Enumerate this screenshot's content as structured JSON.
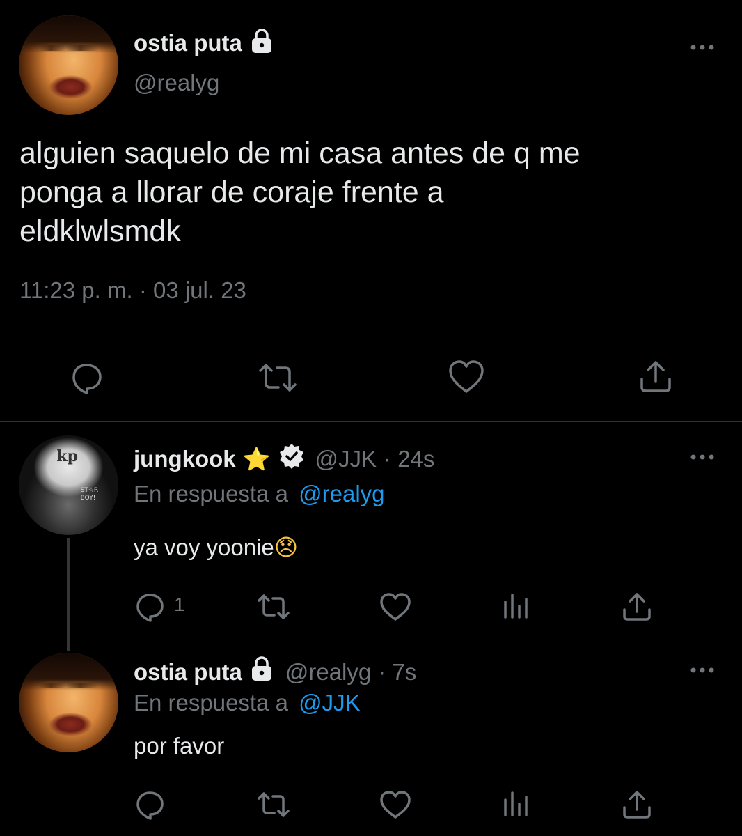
{
  "main_tweet": {
    "display_name": "ostia puta",
    "handle": "@realyg",
    "text_lines": [
      "alguien saquelo de mi casa antes de q me",
      "ponga a llorar de coraje frente a",
      "eldklwlsmdk"
    ],
    "timestamp": "11:23 p. m. · 03 jul. 23",
    "avatar_icon": "avatar-photo",
    "lock_icon": "lock-icon"
  },
  "reply1": {
    "display_name": "jungkook",
    "star_emoji": "⭐",
    "verified_icon": "verified-badge-icon",
    "handle": "@JJK",
    "time": "· 24s",
    "replying_to_prefix": "En respuesta a",
    "replying_to_handle": "@realyg",
    "text": "ya voy yoonie",
    "emoji": "😞",
    "reply_count": "1",
    "avatar_text_logo": "kp",
    "avatar_text_shirt": "ST☆R\nBOY!"
  },
  "reply2": {
    "display_name": "ostia puta",
    "handle": "@realyg",
    "time": "· 7s",
    "replying_to_prefix": "En respuesta a",
    "replying_to_handle": "@JJK",
    "text": "por favor"
  },
  "colors": {
    "background": "#000000",
    "text": "#e7e9ea",
    "muted": "#71767b",
    "link": "#1d9bf0",
    "divider": "#2f3336"
  }
}
